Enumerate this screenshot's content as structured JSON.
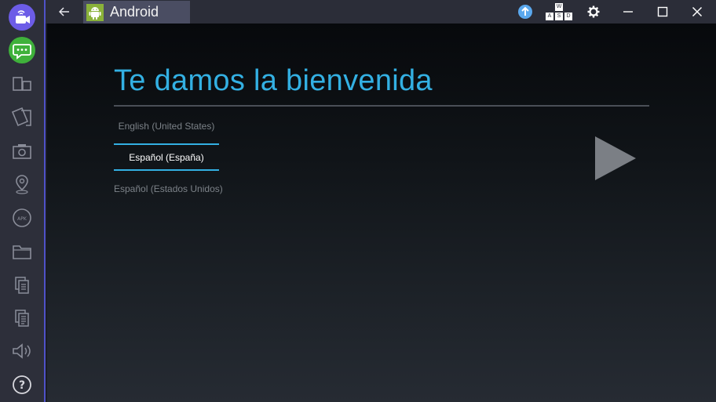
{
  "app": {
    "tab_title": "Android"
  },
  "toolbar": {
    "keymap_keys": [
      "W",
      "A",
      "S",
      "D"
    ]
  },
  "sidebar": {
    "items": [
      {
        "icon": "camera-broadcast-icon"
      },
      {
        "icon": "chat-icon"
      },
      {
        "icon": "multi-instance-icon"
      },
      {
        "icon": "cards-icon"
      },
      {
        "icon": "screenshot-icon"
      },
      {
        "icon": "location-pin-icon"
      },
      {
        "icon": "apk-icon"
      },
      {
        "icon": "folder-icon"
      },
      {
        "icon": "copy-icon"
      },
      {
        "icon": "paste-icon"
      },
      {
        "icon": "volume-icon"
      },
      {
        "icon": "help-icon"
      }
    ]
  },
  "setup": {
    "title": "Te damos la bienvenida",
    "languages": [
      {
        "label": "English (United States)",
        "selected": false
      },
      {
        "label": "Español (España)",
        "selected": true
      },
      {
        "label": "Español (Estados Unidos)",
        "selected": false
      }
    ],
    "next_icon": "play-arrow-icon"
  },
  "colors": {
    "accent": "#33b0e3",
    "sidebar_border": "#4f52c8",
    "android_green": "#8ab23a"
  }
}
